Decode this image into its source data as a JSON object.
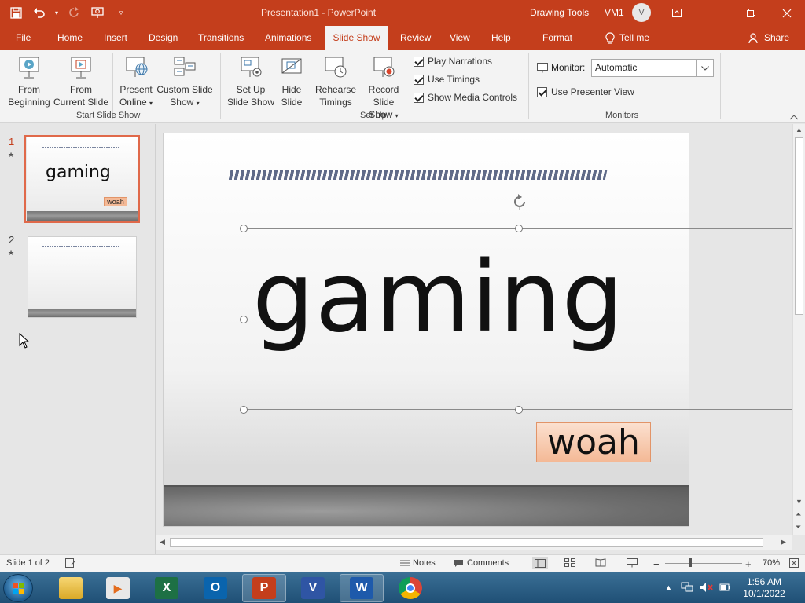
{
  "titlebar": {
    "title": "Presentation1  -  PowerPoint",
    "context_tools": "Drawing Tools",
    "user_name": "VM1",
    "avatar_initial": "V"
  },
  "tabs": {
    "file": "File",
    "home": "Home",
    "insert": "Insert",
    "design": "Design",
    "transitions": "Transitions",
    "animations": "Animations",
    "slideshow": "Slide Show",
    "review": "Review",
    "view": "View",
    "help": "Help",
    "format": "Format",
    "tellme": "Tell me",
    "share": "Share"
  },
  "ribbon": {
    "from_beginning": [
      "From",
      "Beginning"
    ],
    "from_current": [
      "From",
      "Current Slide"
    ],
    "present_online": [
      "Present",
      "Online"
    ],
    "custom_slide_show": [
      "Custom Slide",
      "Show"
    ],
    "group_start": "Start Slide Show",
    "setup_show": [
      "Set Up",
      "Slide Show"
    ],
    "hide_slide": [
      "Hide",
      "Slide"
    ],
    "rehearse": [
      "Rehearse",
      "Timings"
    ],
    "record": [
      "Record Slide",
      "Show"
    ],
    "play_narrations": "Play Narrations",
    "use_timings": "Use Timings",
    "show_media_controls": "Show Media Controls",
    "group_setup": "Set Up",
    "monitor_label": "Monitor:",
    "monitor_value": "Automatic",
    "use_presenter_view": "Use Presenter View",
    "group_monitors": "Monitors"
  },
  "checks": {
    "play_narrations": true,
    "use_timings": true,
    "show_media_controls": true,
    "use_presenter_view": true
  },
  "thumbnails": [
    {
      "number": "1",
      "title": "gaming",
      "subtitle": "woah",
      "active": true
    },
    {
      "number": "2",
      "title": "",
      "subtitle": "",
      "active": false
    }
  ],
  "slide": {
    "title": "gaming",
    "subtitle": "woah"
  },
  "status": {
    "slide_count": "Slide 1 of 2",
    "notes": "Notes",
    "comments": "Comments",
    "zoom": "70%"
  },
  "taskbar": {
    "time": "1:56 AM",
    "date": "10/1/2022"
  },
  "colors": {
    "accent": "#c43e1c",
    "taskbar": "#1f4f75",
    "subtitle_fill": "#f4b996"
  }
}
